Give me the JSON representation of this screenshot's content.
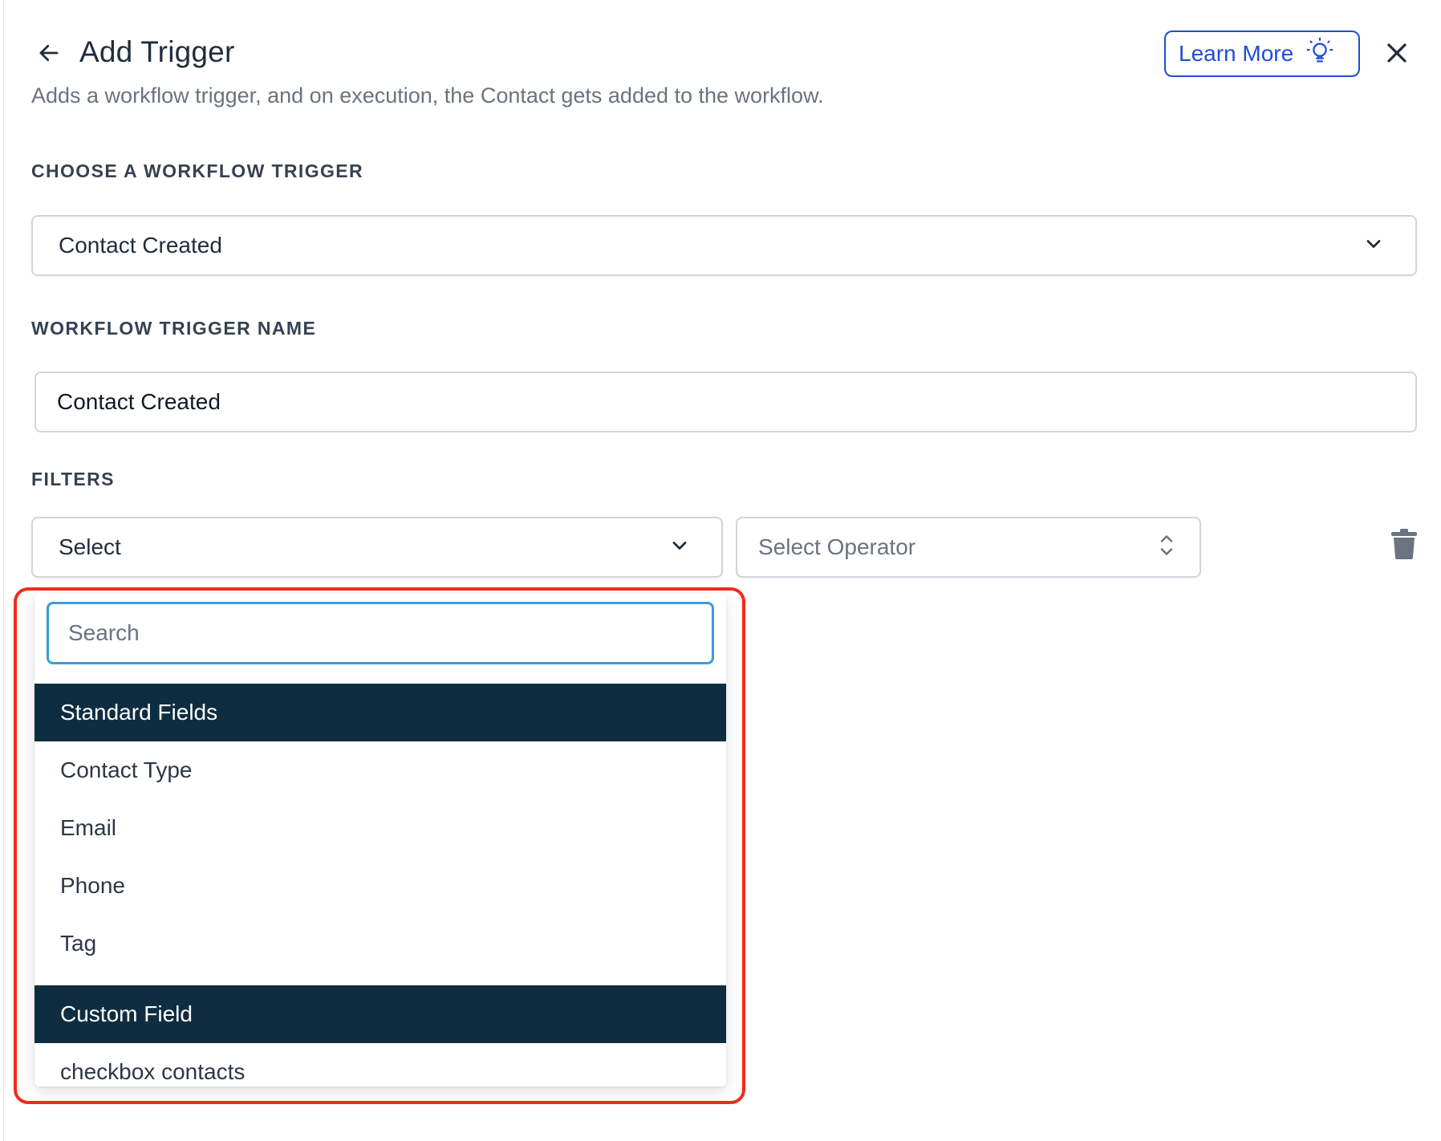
{
  "header": {
    "title": "Add Trigger",
    "subtitle": "Adds a workflow trigger, and on execution, the Contact gets added to the workflow.",
    "learn_more_label": "Learn More"
  },
  "trigger_section": {
    "label": "CHOOSE A WORKFLOW TRIGGER",
    "selected": "Contact Created"
  },
  "name_section": {
    "label": "WORKFLOW TRIGGER NAME",
    "value": "Contact Created"
  },
  "filters": {
    "label": "FILTERS",
    "field_select_value": "Select",
    "operator_placeholder": "Select Operator"
  },
  "dropdown": {
    "search_placeholder": "Search",
    "groups": [
      {
        "header": "Standard Fields",
        "options": [
          "Contact Type",
          "Email",
          "Phone",
          "Tag"
        ]
      },
      {
        "header": "Custom Field",
        "options": [
          "checkbox contacts"
        ]
      }
    ]
  },
  "colors": {
    "accent_blue": "#1d4ed8",
    "search_focus": "#3b9bd9",
    "group_header_bg": "#0f2d40",
    "highlight_red": "#ef2b1c"
  }
}
